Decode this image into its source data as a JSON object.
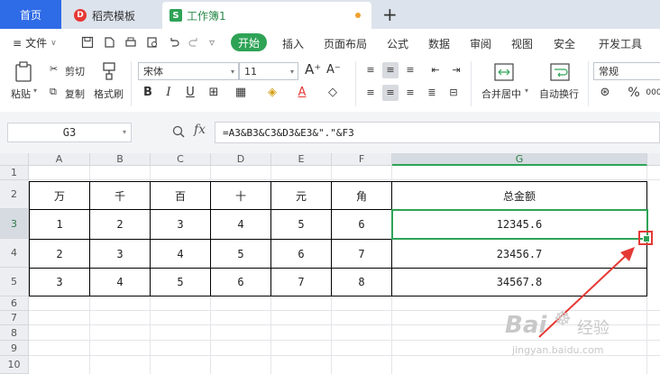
{
  "tabs": {
    "home": "首页",
    "template": "稻壳模板",
    "workbook": "工作簿1",
    "add": "+"
  },
  "menu": {
    "file": "文件",
    "start": "开始",
    "items": [
      "插入",
      "页面布局",
      "公式",
      "数据",
      "审阅",
      "视图",
      "安全",
      "开发工具"
    ]
  },
  "ribbon": {
    "paste": "粘贴",
    "cut": "剪切",
    "copy": "复制",
    "format_painter": "格式刷",
    "font_name": "宋体",
    "font_size": "11",
    "bold": "B",
    "italic": "I",
    "underline": "U",
    "merge_center": "合并居中",
    "auto_wrap": "自动换行",
    "number_format": "常规",
    "percent": "%"
  },
  "formula_bar": {
    "cell_ref": "G3",
    "fx": "fx",
    "formula": "=A3&B3&C3&D3&E3&\".\"&F3"
  },
  "grid": {
    "columns": [
      "A",
      "B",
      "C",
      "D",
      "E",
      "F",
      "G"
    ],
    "rows": [
      "1",
      "2",
      "3",
      "4",
      "5",
      "6",
      "7",
      "8",
      "9",
      "10"
    ],
    "headers": [
      "万",
      "千",
      "百",
      "十",
      "元",
      "角",
      "总金额"
    ],
    "data": [
      [
        "1",
        "2",
        "3",
        "4",
        "5",
        "6",
        "12345.6"
      ],
      [
        "2",
        "3",
        "4",
        "5",
        "6",
        "7",
        "23456.7"
      ],
      [
        "3",
        "4",
        "5",
        "6",
        "7",
        "8",
        "34567.8"
      ]
    ]
  },
  "watermark": {
    "brand": "Bai",
    "brand2": "经验",
    "url": "jingyan.baidu.com"
  },
  "colors": {
    "accent_green": "#2ea356",
    "home_blue": "#2e6be6",
    "annotation_red": "#e53935"
  }
}
